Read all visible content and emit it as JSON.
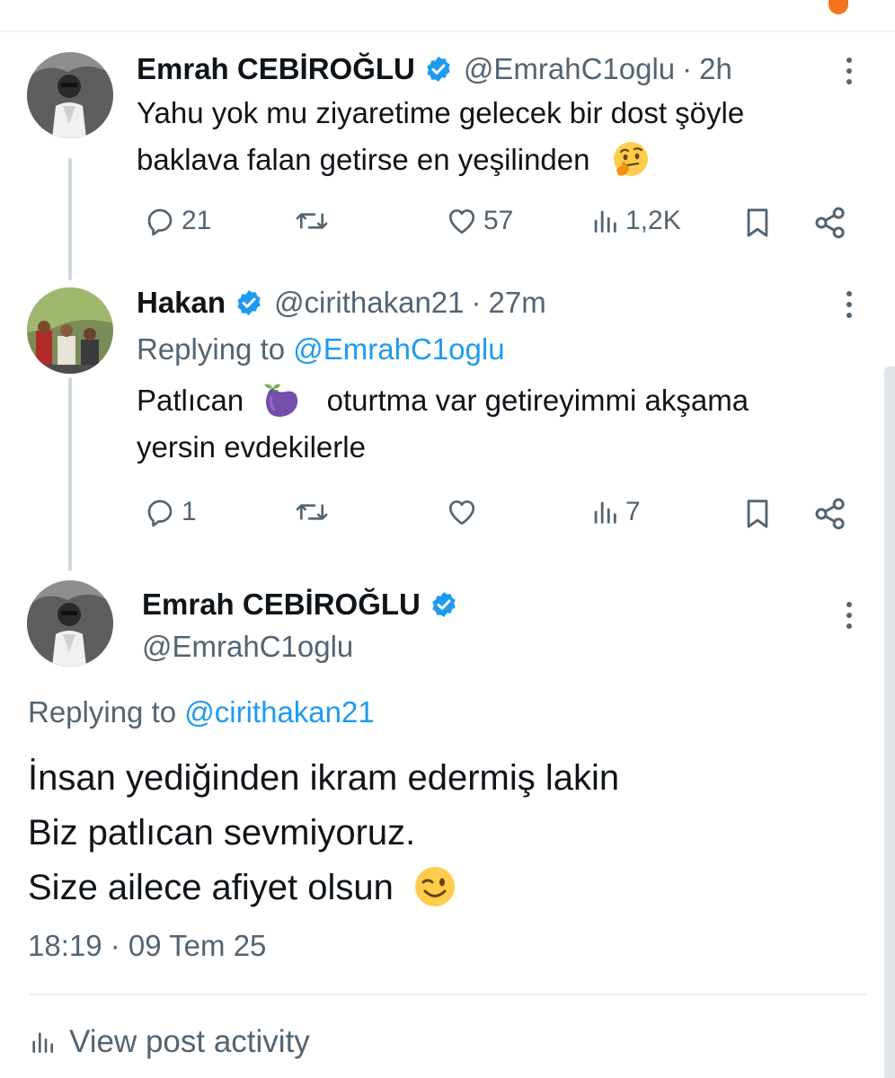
{
  "tweet1": {
    "author_name": "Emrah CEBİROĞLU",
    "handle": "@EmrahC1oglu",
    "separator": "·",
    "time": "2h",
    "text_line1": "Yahu yok mu ziyaretime gelecek bir dost şöyle",
    "text_line2": "baklava falan getirse en yeşilinden",
    "emoji": "thinking-face",
    "replies": "21",
    "retweets": "",
    "likes": "57",
    "views": "1,2K"
  },
  "tweet2": {
    "author_name": "Hakan",
    "handle": "@cirithakan21",
    "separator": "·",
    "time": "27m",
    "replying_label": "Replying to",
    "replying_to": "@EmrahC1oglu",
    "text_line1_before": "Patlıcan",
    "emoji": "eggplant",
    "text_line1_after": "oturtma var getireyimmi akşama",
    "text_line2": "yersin evdekilerle",
    "replies": "1",
    "retweets": "",
    "likes": "",
    "views": "7"
  },
  "main_tweet": {
    "author_name": "Emrah CEBİROĞLU",
    "handle": "@EmrahC1oglu",
    "replying_label": "Replying to",
    "replying_to": "@cirithakan21",
    "text_line1": "İnsan yediğinden ikram edermiş lakin",
    "text_line2": "Biz patlıcan sevmiyoruz.",
    "text_line3": "Size ailece afiyet olsun",
    "emoji": "winking-face",
    "timestamp": "18:19 · 09 Tem 25"
  },
  "activity_link": "View post activity",
  "colors": {
    "text_primary": "#0f1419",
    "text_secondary": "#536471",
    "accent": "#1d9bf0",
    "thread_line": "#cfd9de"
  }
}
